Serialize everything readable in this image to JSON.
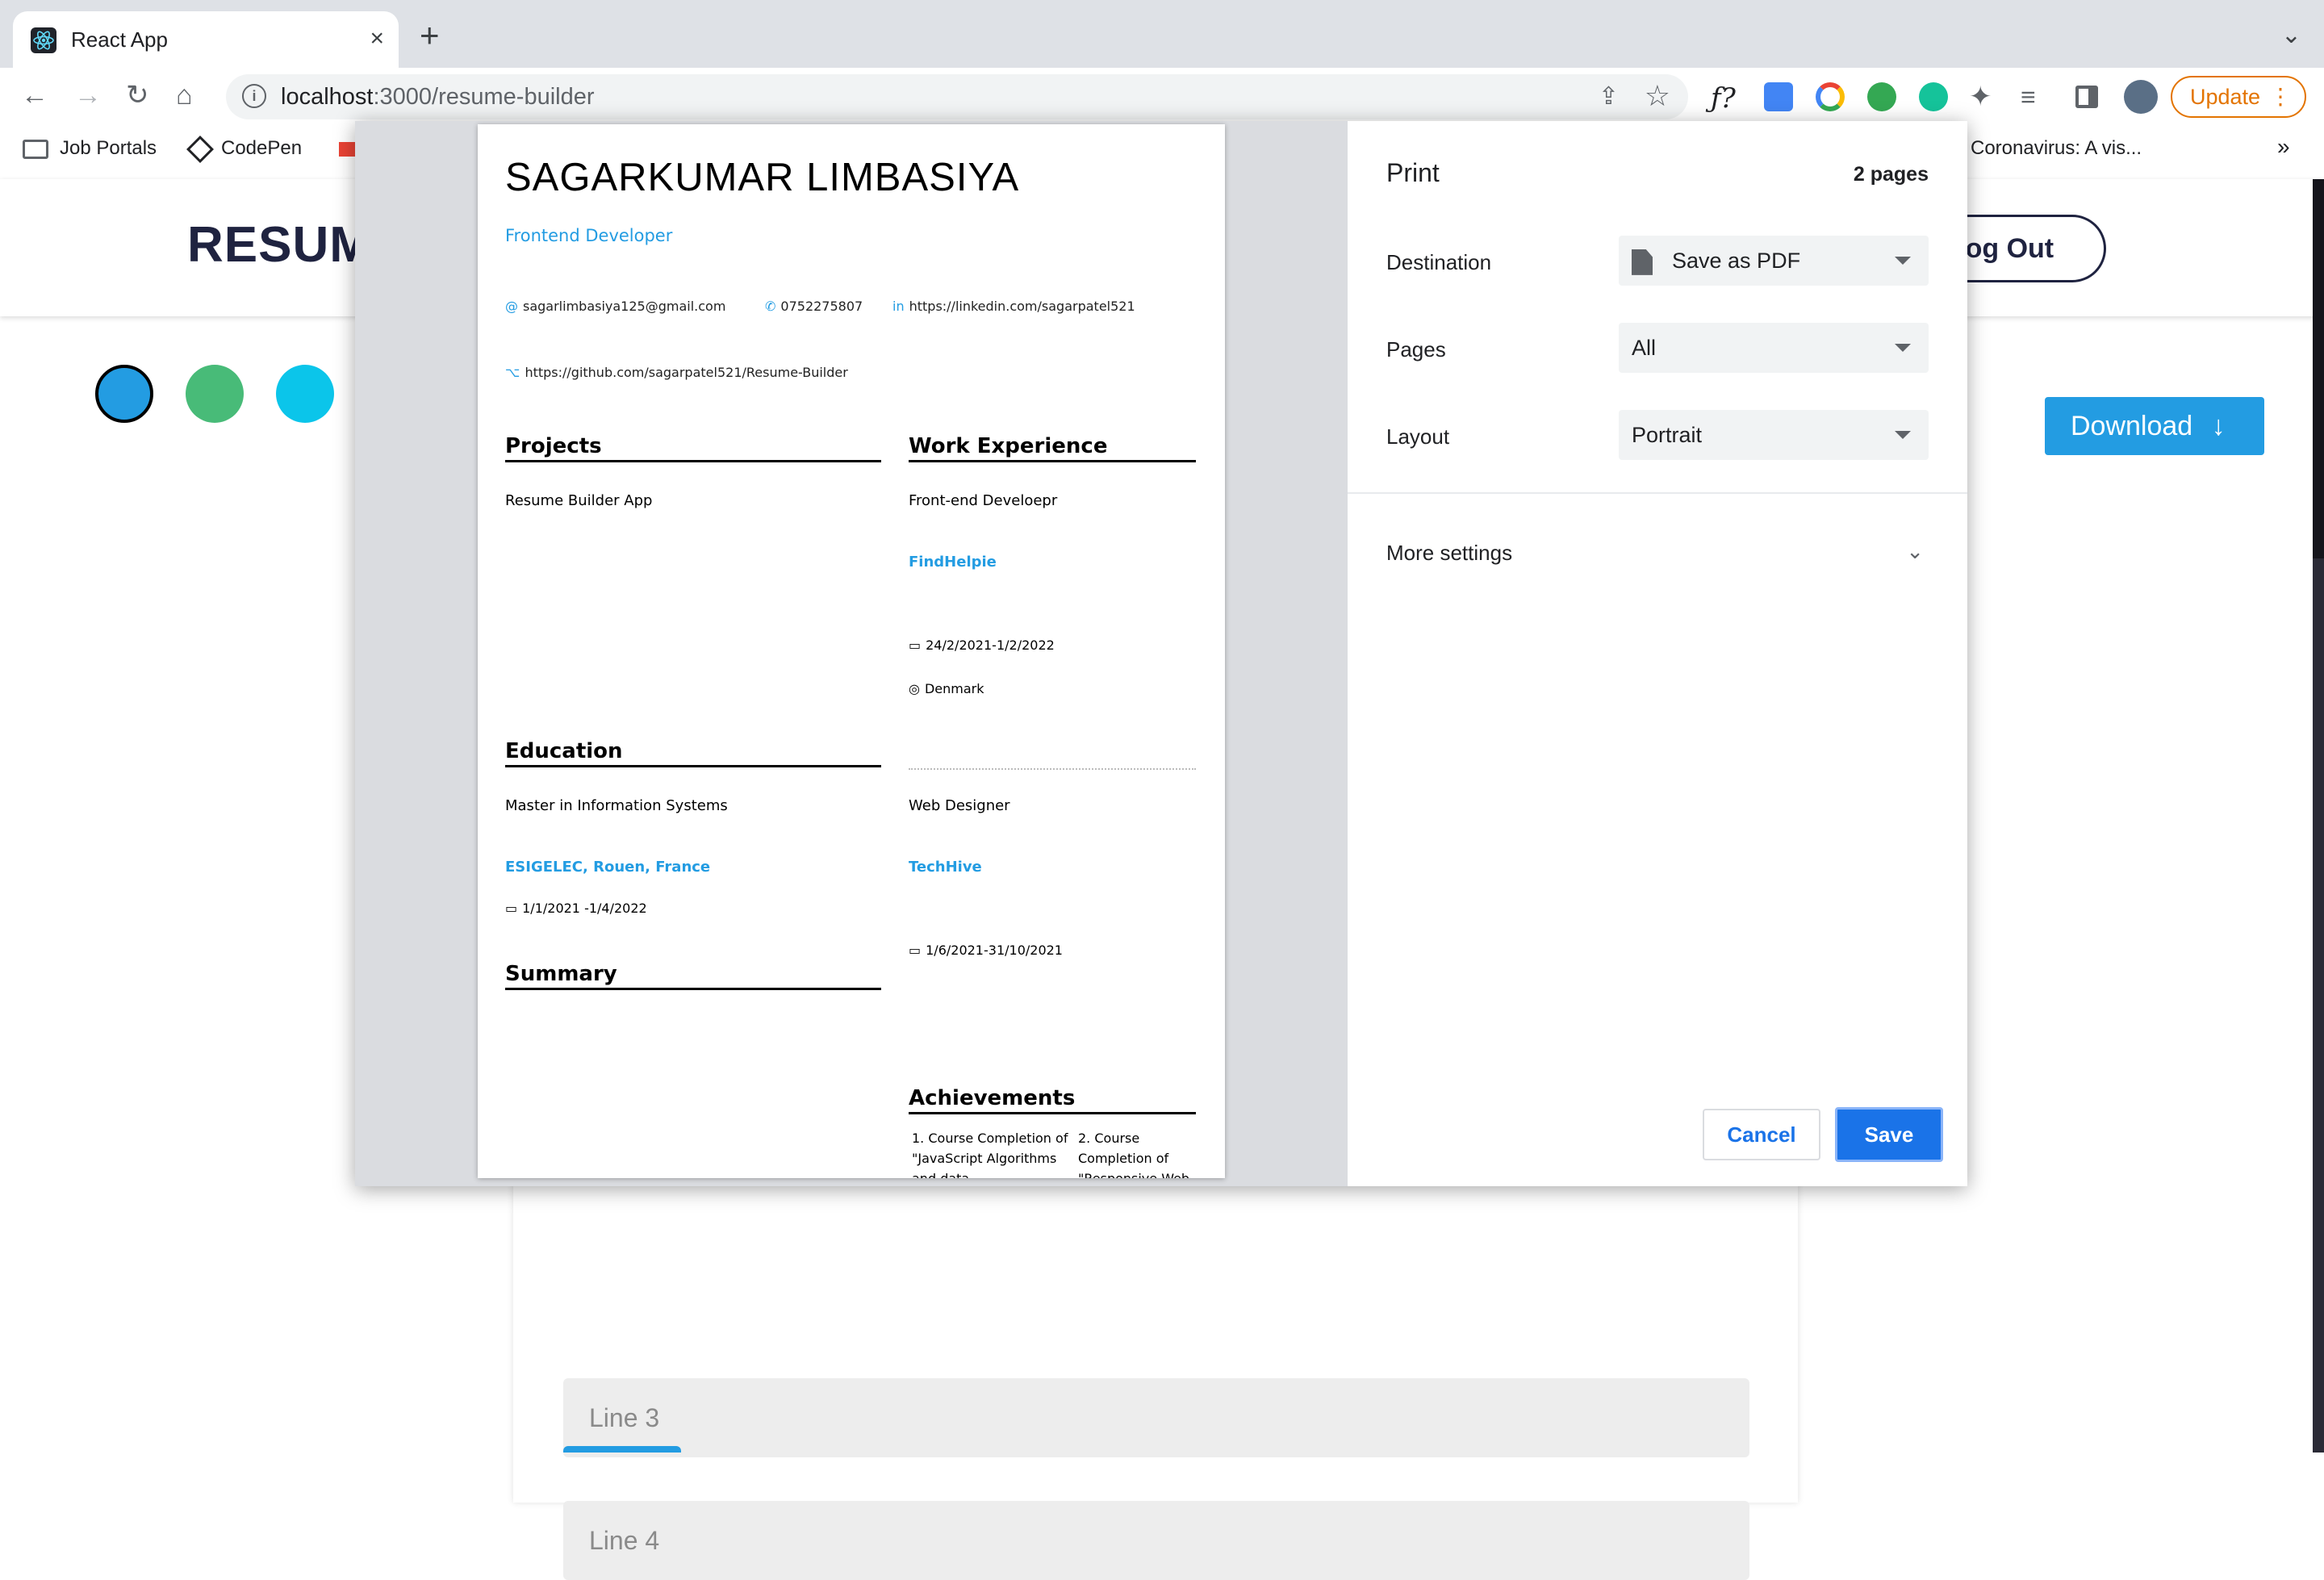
{
  "browser": {
    "tab_title": "React App",
    "tab_close": "×",
    "new_tab": "+",
    "tab_overflow": "⌄",
    "url_host": "localhost",
    "url_rest": ":3000/resume-builder",
    "update_label": "Update",
    "menu_dots": "⋮",
    "nav": {
      "back": "←",
      "forward": "→",
      "reload": "↻",
      "home": "⌂"
    },
    "ext_func": "ƒ?",
    "bookmarks": [
      {
        "label": "Job Portals"
      },
      {
        "label": "CodePen"
      },
      {
        "label": "Coronavirus: A vis..."
      }
    ],
    "bookmarks_overflow": "»"
  },
  "app": {
    "brand": "RESUME",
    "logout_label": "Log Out",
    "download_label": "Download",
    "download_arrow": "↓",
    "theme_colors": [
      "#239ce2",
      "#48bb78",
      "#0bc5ea"
    ],
    "lines": [
      {
        "placeholder": "Line 3"
      },
      {
        "placeholder": "Line 4"
      }
    ]
  },
  "resume": {
    "name": "SAGARKUMAR LIMBASIYA",
    "role": "Frontend Developer",
    "email": "sagarlimbasiya125@gmail.com",
    "phone": "0752275807",
    "linkedin": "https://linkedin.com/sagarpatel521",
    "github": "https://github.com/sagarpatel521/Resume-Builder",
    "sections": {
      "projects": "Projects",
      "work": "Work Experience",
      "education": "Education",
      "summary": "Summary",
      "achievements": "Achievements"
    },
    "project_1": "Resume Builder App",
    "work_1": {
      "title": "Front-end Develoepr",
      "company": "FindHelpie",
      "dates": "24/2/2021-1/2/2022",
      "location": "Denmark"
    },
    "work_2": {
      "title": "Web Designer",
      "company": "TechHive",
      "dates": "1/6/2021-31/10/2021"
    },
    "education_1": {
      "degree": "Master in Information Systems",
      "school": "ESIGELEC, Rouen, France",
      "dates": "1/1/2021 -1/4/2022"
    },
    "achievements": [
      "1. Course Completion of \"JavaScript Algorithms and data",
      "2. Course Completion of \"Responsive Web"
    ]
  },
  "print": {
    "title": "Print",
    "page_count": "2 pages",
    "destination_label": "Destination",
    "destination_value": "Save as PDF",
    "pages_label": "Pages",
    "pages_value": "All",
    "layout_label": "Layout",
    "layout_value": "Portrait",
    "more_settings": "More settings",
    "cancel": "Cancel",
    "save": "Save"
  }
}
